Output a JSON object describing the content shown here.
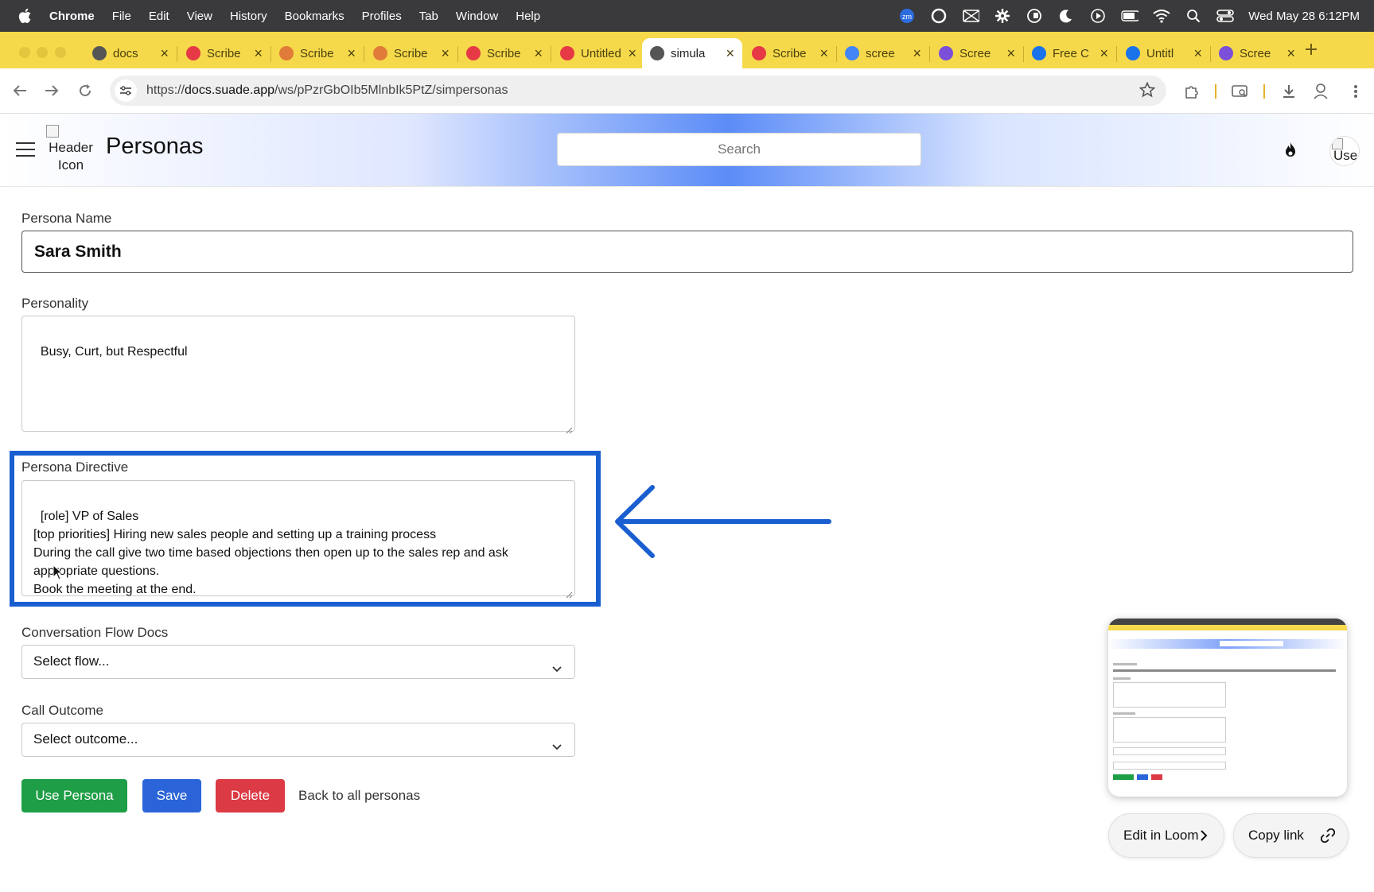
{
  "menubar": {
    "app": "Chrome",
    "items": [
      "File",
      "Edit",
      "View",
      "History",
      "Bookmarks",
      "Profiles",
      "Tab",
      "Window",
      "Help"
    ],
    "zoom_badge": "zm",
    "clock": "Wed May 28  6:12PM"
  },
  "tabs": [
    {
      "title": "docs",
      "icon": "link-icon",
      "color": "#555555"
    },
    {
      "title": "Scribe",
      "icon": "scribe-icon",
      "color": "#e63946"
    },
    {
      "title": "Scribe",
      "icon": "scribe-rainbow-icon",
      "color": "#e07b39"
    },
    {
      "title": "Scribe",
      "icon": "scribe-rainbow-icon",
      "color": "#e07b39"
    },
    {
      "title": "Scribe",
      "icon": "scribe-icon",
      "color": "#e63946"
    },
    {
      "title": "Untitled",
      "icon": "scribe-icon",
      "color": "#e63946"
    },
    {
      "title": "simula",
      "icon": "link-icon",
      "color": "#555555",
      "active": true
    },
    {
      "title": "Scribe",
      "icon": "scribe-icon",
      "color": "#e63946"
    },
    {
      "title": "scree",
      "icon": "google-icon",
      "color": "#4285f4"
    },
    {
      "title": "Scree",
      "icon": "puzzle-icon",
      "color": "#7b4fd8"
    },
    {
      "title": "Free C",
      "icon": "c-icon",
      "color": "#1a73e8"
    },
    {
      "title": "Untitl",
      "icon": "c-icon",
      "color": "#1a73e8"
    },
    {
      "title": "Scree",
      "icon": "puzzle-icon",
      "color": "#7b4fd8"
    }
  ],
  "address": {
    "host": "docs.suade.app",
    "path": "/ws/pPzrGbOIb5MlnbIk5PtZ/simpersonas",
    "prefix": "https://"
  },
  "header": {
    "image_alt": "Header Icon",
    "title": "Personas",
    "search_placeholder": "Search",
    "avatar_alt": "Use"
  },
  "form": {
    "name_label": "Persona Name",
    "name_value": "Sara Smith",
    "personality_label": "Personality",
    "personality_value": "Busy, Curt, but Respectful",
    "directive_label": "Persona Directive",
    "directive_value": "[role] VP of Sales\n[top priorities] Hiring new sales people and setting up a training process\nDuring the call give two time based objections then open up to the sales rep and ask appropriate questions.\nBook the meeting at the end.",
    "flow_label": "Conversation Flow Docs",
    "flow_value": "Select flow...",
    "outcome_label": "Call Outcome",
    "outcome_value": "Select outcome...",
    "use_button": "Use Persona",
    "save_button": "Save",
    "delete_button": "Delete",
    "back_link": "Back to all personas"
  },
  "loom": {
    "edit_label": "Edit in Loom",
    "copy_label": "Copy link"
  },
  "colors": {
    "accent_highlight": "#1a5fd0",
    "use_green": "#1e9e46",
    "save_blue": "#2a64d8",
    "delete_red": "#dc3a44",
    "tab_strip": "#f5d94a"
  }
}
